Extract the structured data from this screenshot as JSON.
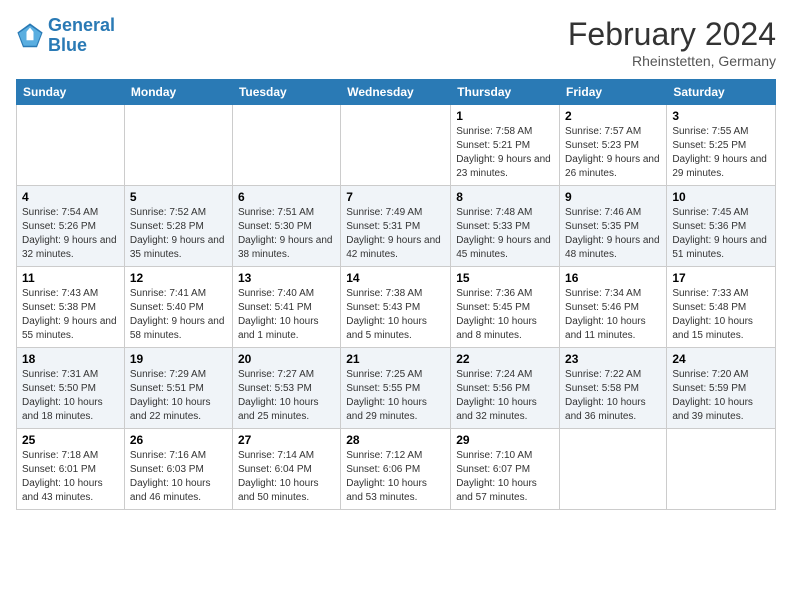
{
  "header": {
    "logo_line1": "General",
    "logo_line2": "Blue",
    "month_year": "February 2024",
    "location": "Rheinstetten, Germany"
  },
  "weekdays": [
    "Sunday",
    "Monday",
    "Tuesday",
    "Wednesday",
    "Thursday",
    "Friday",
    "Saturday"
  ],
  "weeks": [
    [
      {
        "day": "",
        "info": ""
      },
      {
        "day": "",
        "info": ""
      },
      {
        "day": "",
        "info": ""
      },
      {
        "day": "",
        "info": ""
      },
      {
        "day": "1",
        "info": "Sunrise: 7:58 AM\nSunset: 5:21 PM\nDaylight: 9 hours\nand 23 minutes."
      },
      {
        "day": "2",
        "info": "Sunrise: 7:57 AM\nSunset: 5:23 PM\nDaylight: 9 hours\nand 26 minutes."
      },
      {
        "day": "3",
        "info": "Sunrise: 7:55 AM\nSunset: 5:25 PM\nDaylight: 9 hours\nand 29 minutes."
      }
    ],
    [
      {
        "day": "4",
        "info": "Sunrise: 7:54 AM\nSunset: 5:26 PM\nDaylight: 9 hours\nand 32 minutes."
      },
      {
        "day": "5",
        "info": "Sunrise: 7:52 AM\nSunset: 5:28 PM\nDaylight: 9 hours\nand 35 minutes."
      },
      {
        "day": "6",
        "info": "Sunrise: 7:51 AM\nSunset: 5:30 PM\nDaylight: 9 hours\nand 38 minutes."
      },
      {
        "day": "7",
        "info": "Sunrise: 7:49 AM\nSunset: 5:31 PM\nDaylight: 9 hours\nand 42 minutes."
      },
      {
        "day": "8",
        "info": "Sunrise: 7:48 AM\nSunset: 5:33 PM\nDaylight: 9 hours\nand 45 minutes."
      },
      {
        "day": "9",
        "info": "Sunrise: 7:46 AM\nSunset: 5:35 PM\nDaylight: 9 hours\nand 48 minutes."
      },
      {
        "day": "10",
        "info": "Sunrise: 7:45 AM\nSunset: 5:36 PM\nDaylight: 9 hours\nand 51 minutes."
      }
    ],
    [
      {
        "day": "11",
        "info": "Sunrise: 7:43 AM\nSunset: 5:38 PM\nDaylight: 9 hours\nand 55 minutes."
      },
      {
        "day": "12",
        "info": "Sunrise: 7:41 AM\nSunset: 5:40 PM\nDaylight: 9 hours\nand 58 minutes."
      },
      {
        "day": "13",
        "info": "Sunrise: 7:40 AM\nSunset: 5:41 PM\nDaylight: 10 hours\nand 1 minute."
      },
      {
        "day": "14",
        "info": "Sunrise: 7:38 AM\nSunset: 5:43 PM\nDaylight: 10 hours\nand 5 minutes."
      },
      {
        "day": "15",
        "info": "Sunrise: 7:36 AM\nSunset: 5:45 PM\nDaylight: 10 hours\nand 8 minutes."
      },
      {
        "day": "16",
        "info": "Sunrise: 7:34 AM\nSunset: 5:46 PM\nDaylight: 10 hours\nand 11 minutes."
      },
      {
        "day": "17",
        "info": "Sunrise: 7:33 AM\nSunset: 5:48 PM\nDaylight: 10 hours\nand 15 minutes."
      }
    ],
    [
      {
        "day": "18",
        "info": "Sunrise: 7:31 AM\nSunset: 5:50 PM\nDaylight: 10 hours\nand 18 minutes."
      },
      {
        "day": "19",
        "info": "Sunrise: 7:29 AM\nSunset: 5:51 PM\nDaylight: 10 hours\nand 22 minutes."
      },
      {
        "day": "20",
        "info": "Sunrise: 7:27 AM\nSunset: 5:53 PM\nDaylight: 10 hours\nand 25 minutes."
      },
      {
        "day": "21",
        "info": "Sunrise: 7:25 AM\nSunset: 5:55 PM\nDaylight: 10 hours\nand 29 minutes."
      },
      {
        "day": "22",
        "info": "Sunrise: 7:24 AM\nSunset: 5:56 PM\nDaylight: 10 hours\nand 32 minutes."
      },
      {
        "day": "23",
        "info": "Sunrise: 7:22 AM\nSunset: 5:58 PM\nDaylight: 10 hours\nand 36 minutes."
      },
      {
        "day": "24",
        "info": "Sunrise: 7:20 AM\nSunset: 5:59 PM\nDaylight: 10 hours\nand 39 minutes."
      }
    ],
    [
      {
        "day": "25",
        "info": "Sunrise: 7:18 AM\nSunset: 6:01 PM\nDaylight: 10 hours\nand 43 minutes."
      },
      {
        "day": "26",
        "info": "Sunrise: 7:16 AM\nSunset: 6:03 PM\nDaylight: 10 hours\nand 46 minutes."
      },
      {
        "day": "27",
        "info": "Sunrise: 7:14 AM\nSunset: 6:04 PM\nDaylight: 10 hours\nand 50 minutes."
      },
      {
        "day": "28",
        "info": "Sunrise: 7:12 AM\nSunset: 6:06 PM\nDaylight: 10 hours\nand 53 minutes."
      },
      {
        "day": "29",
        "info": "Sunrise: 7:10 AM\nSunset: 6:07 PM\nDaylight: 10 hours\nand 57 minutes."
      },
      {
        "day": "",
        "info": ""
      },
      {
        "day": "",
        "info": ""
      }
    ]
  ]
}
